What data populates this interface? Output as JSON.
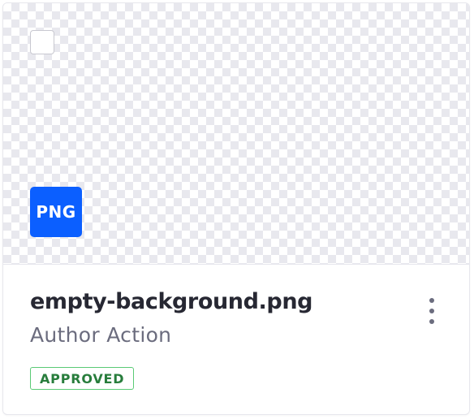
{
  "card": {
    "file_type": "PNG",
    "title": "empty-background.png",
    "subtitle": "Author Action",
    "status": "APPROVED",
    "menu_icon": "ellipsis-v-icon",
    "select_icon": "checkbox-icon"
  },
  "colors": {
    "file_type_badge": "#0b5fff",
    "title_text": "#272833",
    "subtitle_text": "#6b6c7e",
    "status_text": "#287d3c",
    "status_border": "#5aca75"
  }
}
